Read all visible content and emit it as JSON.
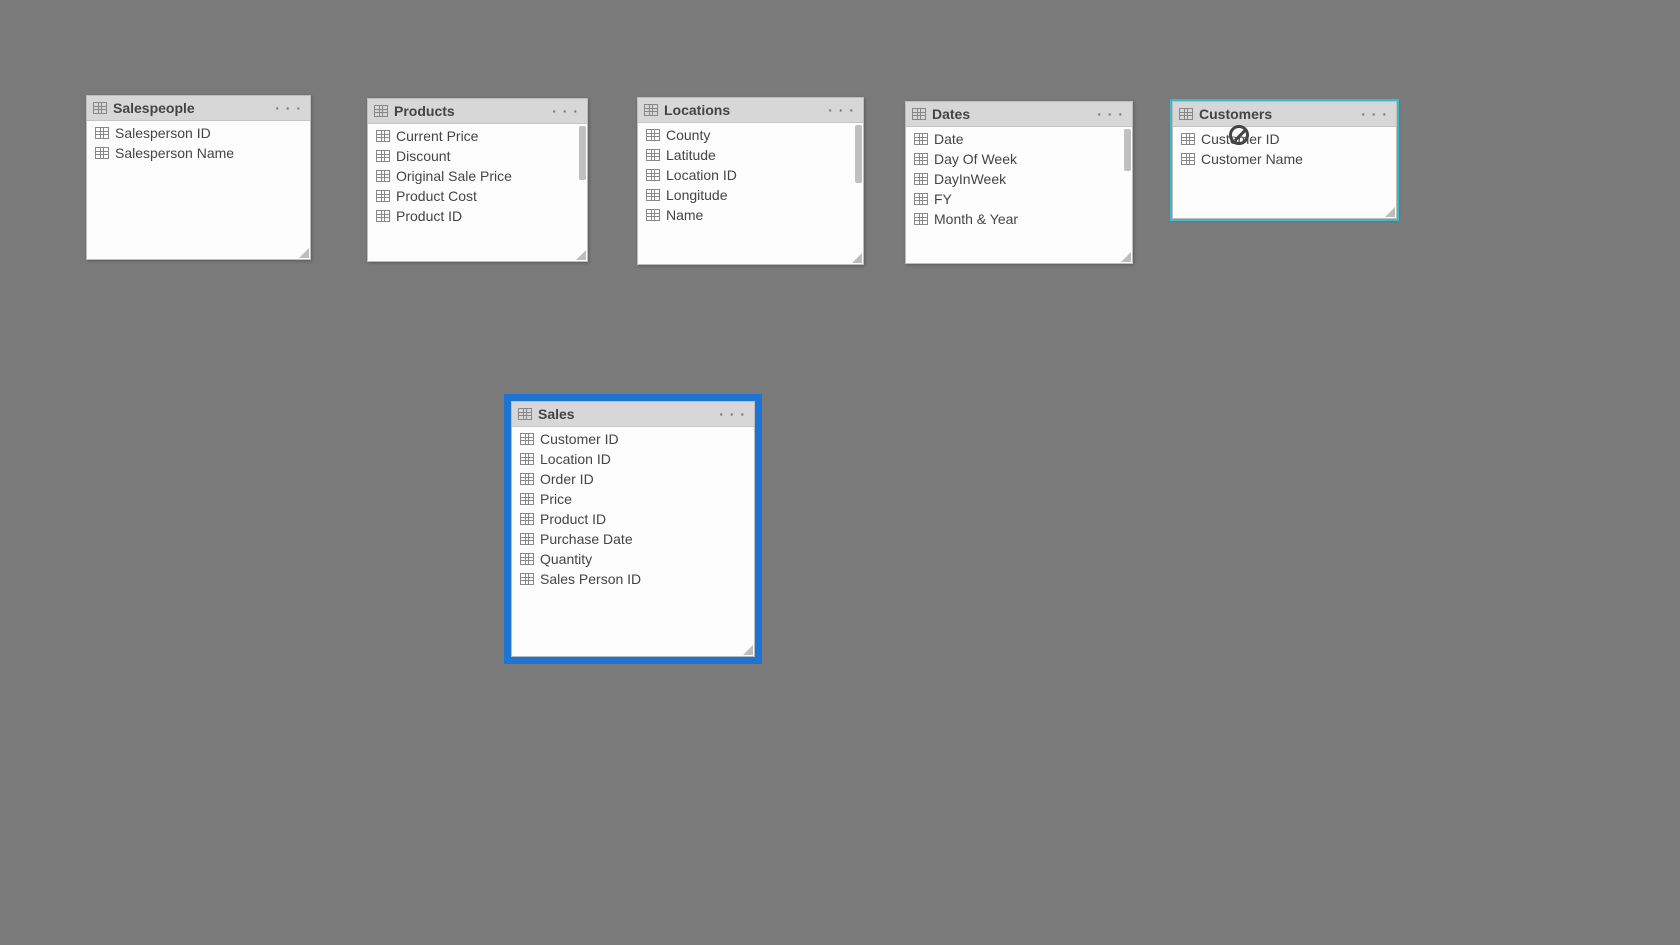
{
  "tables": {
    "salespeople": {
      "title": "Salespeople",
      "fields": [
        "Salesperson ID",
        "Salesperson Name"
      ]
    },
    "products": {
      "title": "Products",
      "fields": [
        "Current Price",
        "Discount",
        "Original Sale Price",
        "Product Cost",
        "Product ID"
      ]
    },
    "locations": {
      "title": "Locations",
      "fields": [
        "County",
        "Latitude",
        "Location ID",
        "Longitude",
        "Name"
      ]
    },
    "dates": {
      "title": "Dates",
      "fields": [
        "Date",
        "Day Of Week",
        "DayInWeek",
        "FY",
        "Month & Year"
      ]
    },
    "customers": {
      "title": "Customers",
      "fields": [
        "Customer ID",
        "Customer Name"
      ]
    },
    "sales": {
      "title": "Sales",
      "fields": [
        "Customer ID",
        "Location ID",
        "Order ID",
        "Price",
        "Product ID",
        "Purchase Date",
        "Quantity",
        "Sales Person ID"
      ]
    }
  },
  "more_label": "· · ·"
}
